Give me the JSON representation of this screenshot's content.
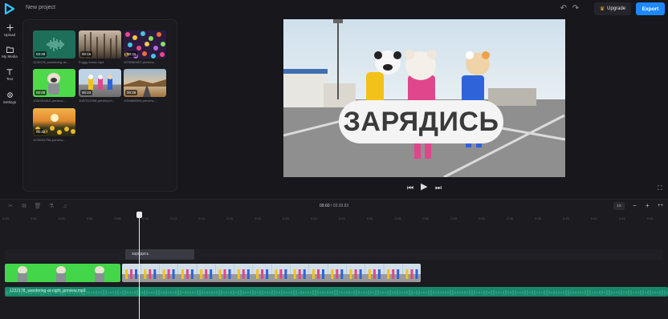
{
  "app": {
    "project_title": "New project"
  },
  "toolbar": {
    "upgrade_label": "Upgrade",
    "export_label": "Export"
  },
  "sidebar": {
    "items": [
      {
        "label": "Upload",
        "icon": "plus-icon"
      },
      {
        "label": "My Media",
        "icon": "folder-icon"
      },
      {
        "label": "Text",
        "icon": "text-icon"
      },
      {
        "label": "Settings",
        "icon": "gear-icon"
      }
    ]
  },
  "media": {
    "items": [
      {
        "duration": "03:28",
        "name": "1232178_wandering-at-...",
        "kind": "audio"
      },
      {
        "duration": "00:15",
        "name": "Foggy-forest.mp4",
        "kind": "forest"
      },
      {
        "duration": "00:21",
        "name": "1076380907-preview...",
        "kind": "confetti"
      },
      {
        "duration": "00:08",
        "name": "1082354810-preview....",
        "kind": "green"
      },
      {
        "duration": "00:23",
        "name": "1087312068-preview.m...",
        "kind": "dancers"
      },
      {
        "duration": "00:28",
        "name": "1054868504-preview....",
        "kind": "desert"
      },
      {
        "duration": "00:22",
        "name": "1078254756-preview....",
        "kind": "sunflower"
      }
    ]
  },
  "preview": {
    "caption": "ЗАРЯДИСЬ"
  },
  "timeline": {
    "current_time": "09.60",
    "separator": "/",
    "total_time": "03:28.83",
    "fit_label": "1X",
    "ruler_labels": [
      "0:00",
      "0:02",
      "0:04",
      "0:06",
      "0:08",
      "0:10",
      "0:12",
      "0:14",
      "0:16",
      "0:18",
      "0:20",
      "0:22",
      "0:24",
      "0:26",
      "0:28",
      "0:30",
      "0:32",
      "0:34",
      "0:36",
      "0:38",
      "0:40",
      "0:42",
      "0:44",
      "0:46"
    ],
    "text_clip_label": "зарядись",
    "audio_clip_label": "1232178_wandering-at-night_preview.mp3"
  },
  "colors": {
    "accent": "#1e88ff",
    "audio": "#17896a",
    "green_screen": "#43d64a"
  }
}
